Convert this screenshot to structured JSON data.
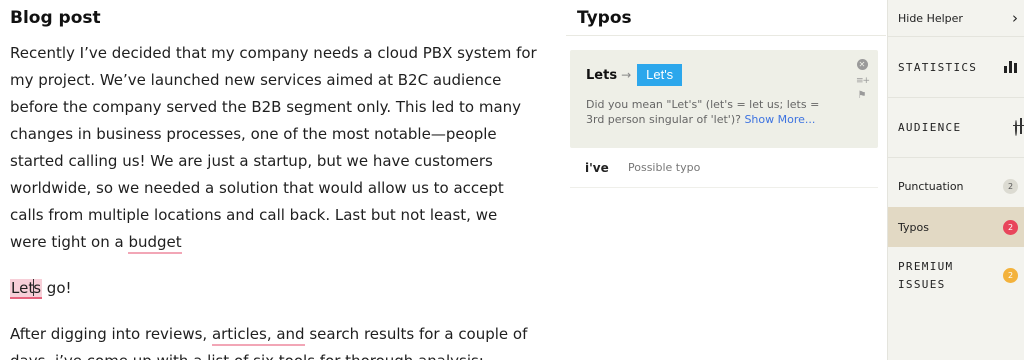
{
  "editor": {
    "title": "Blog post",
    "p1": {
      "text_before_underline": "Recently I’ve decided that my company needs a cloud PBX system for my project. We’ve launched new services aimed at B2C audience before the company served the B2B segment only. This led to many changes in business processes, one of the most notable—people started calling us! We are just a startup, but we have customers worldwide, so we needed a solution that would allow us to accept calls from multiple locations and call back. Last but not least, we were tight on a ",
      "underlined_word": "budget"
    },
    "p2": {
      "highlight_a": "Let",
      "highlight_b": "s",
      "rest": " go!"
    },
    "p3": {
      "before": "After digging into reviews, ",
      "underlined": "articles, and",
      "middle": " search results for a couple of days, ",
      "underlined_2": "i’ve",
      "after": " come up with a list of six tools for thorough analysis:"
    }
  },
  "typos_panel": {
    "header": "Typos",
    "card": {
      "original": "Lets",
      "arrow": "→",
      "suggestion": "Let's",
      "description": "Did you mean \"Let's\" (let's = let us; lets = 3rd person singular of 'let')? ",
      "show_more": "Show More...",
      "close_icon": "close-circle-icon",
      "dictionary_icon": "add-to-dictionary-icon",
      "flag_icon": "flag-icon"
    },
    "issue": {
      "word": "i've",
      "label": "Possible typo"
    }
  },
  "sidebar": {
    "hide_helper": "Hide Helper",
    "statistics": "STATISTICS",
    "audience": "AUDIENCE",
    "punctuation": {
      "label": "Punctuation",
      "count": "2"
    },
    "typos": {
      "label": "Typos",
      "count": "2"
    },
    "premium": {
      "label_line1": "PREMIUM",
      "label_line2": "ISSUES",
      "count": "2"
    }
  },
  "colors": {
    "accent_blue": "#2ca7ec",
    "error_red": "#e8455b",
    "premium_orange": "#f3b23c",
    "selected_bg": "#e2d9c4"
  }
}
